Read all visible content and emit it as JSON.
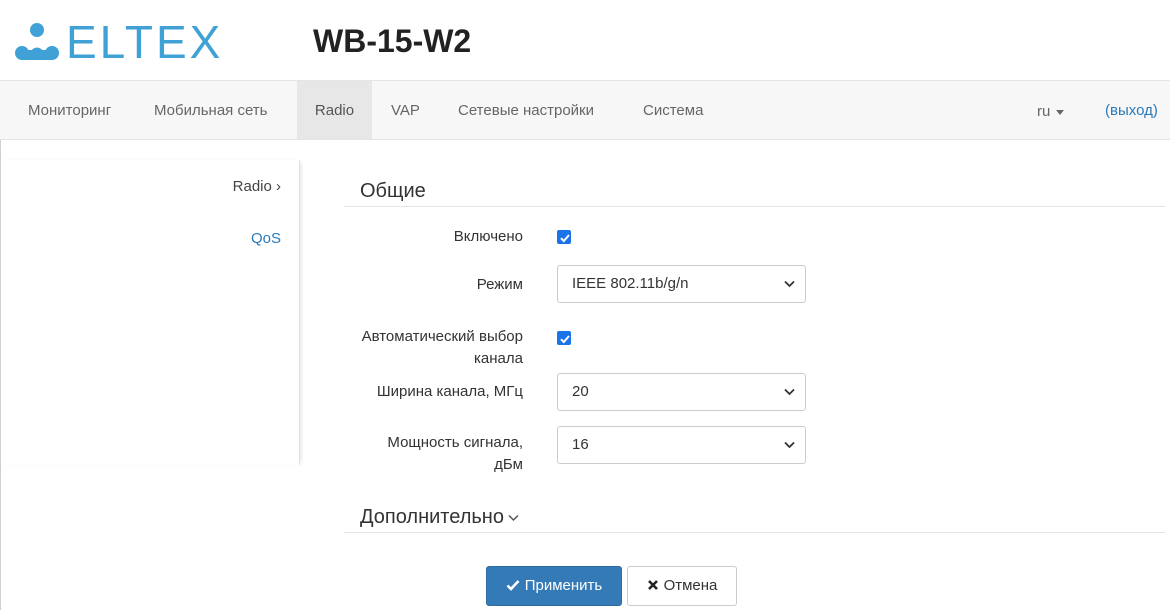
{
  "header": {
    "logo_text": "ELTEX",
    "model": "WB-15-W2",
    "brand_color": "#3fa1d5"
  },
  "nav": {
    "items": [
      {
        "label": "Мониторинг"
      },
      {
        "label": "Мобильная сеть"
      },
      {
        "label": "Radio"
      },
      {
        "label": "VAP"
      },
      {
        "label": "Сетевые настройки"
      },
      {
        "label": "Система"
      }
    ],
    "active": "Radio",
    "lang": "ru",
    "logout": "(выход)"
  },
  "sidebar": {
    "items": [
      {
        "label": "Radio ›",
        "active": true
      },
      {
        "label": "QoS",
        "active": false
      }
    ]
  },
  "main": {
    "general_title": "Общие",
    "enabled_label": "Включено",
    "enabled_checked": true,
    "mode_label": "Режим",
    "mode_value": "IEEE 802.11b/g/n",
    "auto_channel_label_1": "Автоматический выбор",
    "auto_channel_label_2": "канала",
    "auto_channel_checked": true,
    "width_label": "Ширина канала, МГц",
    "width_value": "20",
    "power_label_1": "Мощность сигнала,",
    "power_label_2": "дБм",
    "power_value": "16",
    "advanced_title": "Дополнительно"
  },
  "actions": {
    "apply": "Применить",
    "cancel": "Отмена"
  },
  "colors": {
    "accent": "#337ab7",
    "link": "#2a7ab9",
    "checkbox": "#1a73e8"
  }
}
